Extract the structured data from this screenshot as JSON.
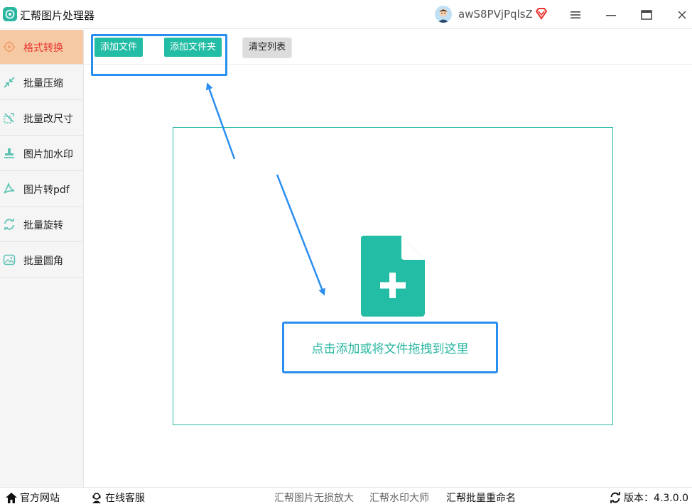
{
  "app": {
    "title": "汇帮图片处理器",
    "username": "awS8PVjPqlsZ"
  },
  "colors": {
    "accent": "#22bda4",
    "highlight": "#2a8ef0",
    "active_tab": "#f6c9a5",
    "active_text": "#e8322c"
  },
  "sidebar": {
    "items": [
      {
        "label": "格式转换",
        "icon": "format-convert-icon",
        "active": true
      },
      {
        "label": "批量压缩",
        "icon": "compress-icon",
        "active": false
      },
      {
        "label": "批量改尺寸",
        "icon": "resize-icon",
        "active": false
      },
      {
        "label": "图片加水印",
        "icon": "watermark-icon",
        "active": false
      },
      {
        "label": "图片转pdf",
        "icon": "pdf-icon",
        "active": false
      },
      {
        "label": "批量旋转",
        "icon": "rotate-icon",
        "active": false
      },
      {
        "label": "批量圆角",
        "icon": "rounded-corner-icon",
        "active": false
      }
    ]
  },
  "toolbar": {
    "add_file": "添加文件",
    "add_folder": "添加文件夹",
    "clear_list": "清空列表"
  },
  "dropzone": {
    "hint": "点击添加或将文件拖拽到这里"
  },
  "statusbar": {
    "official_site": "官方网站",
    "online_service": "在线客服",
    "link1": "汇帮图片无损放大",
    "link2": "汇帮水印大师",
    "link3": "汇帮批量重命名",
    "version": "版本：4.3.0.0"
  }
}
